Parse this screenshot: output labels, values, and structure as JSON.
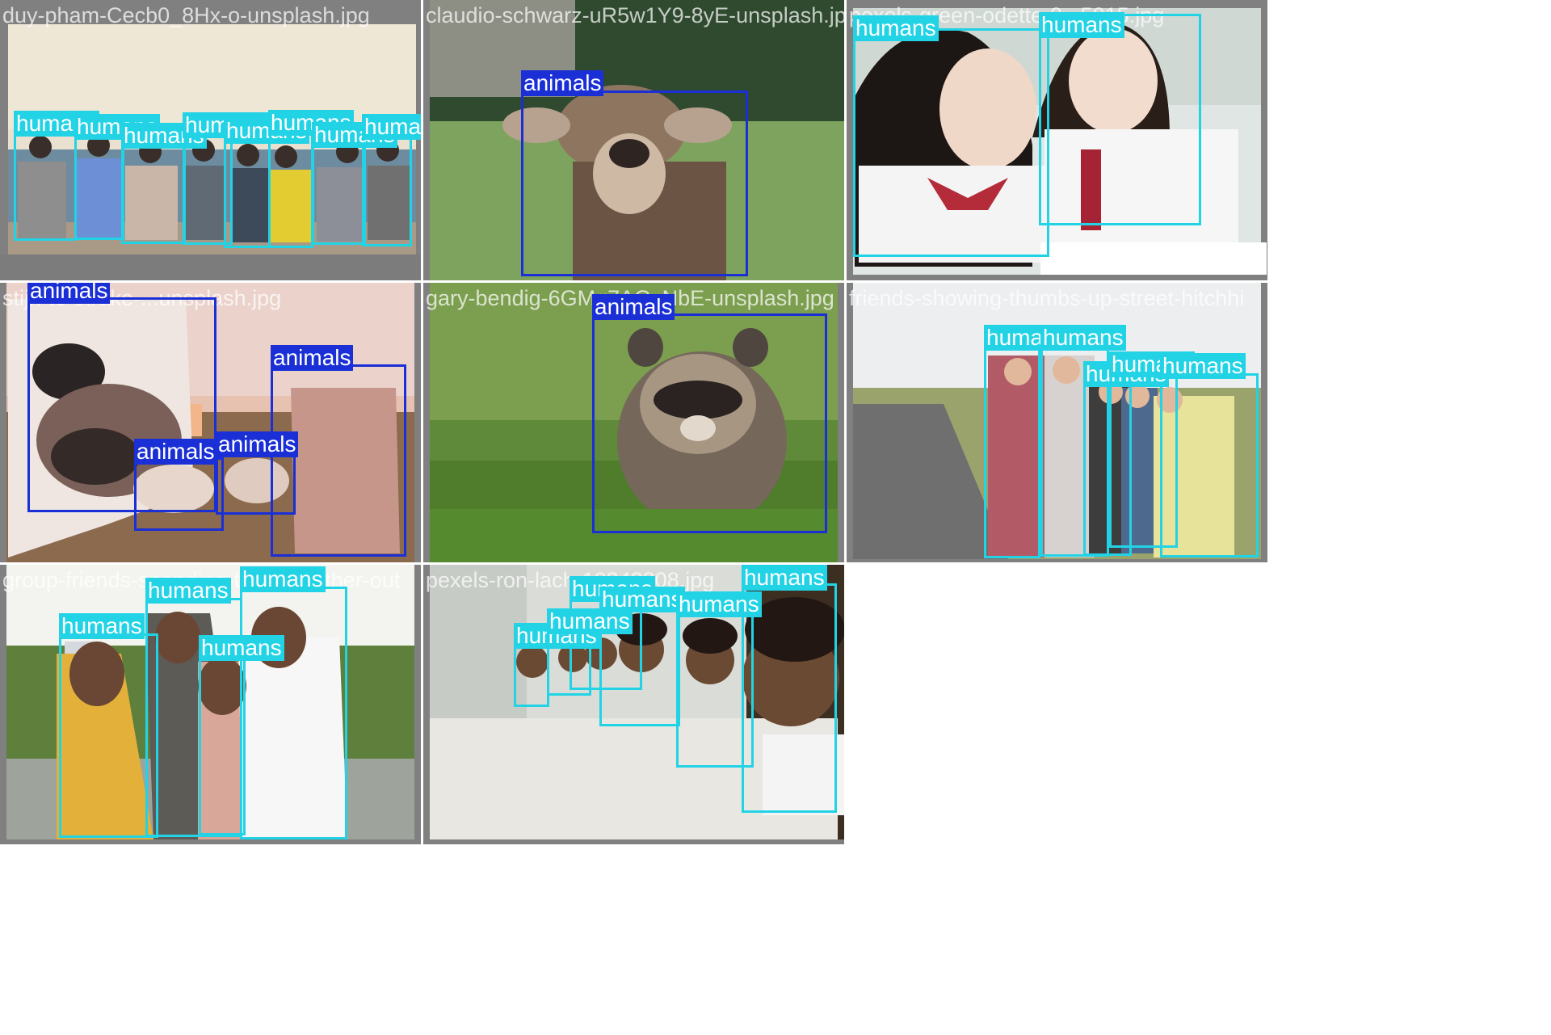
{
  "colors": {
    "humans": "#22d3e6",
    "animals": "#1a2fd6"
  },
  "class_names": {
    "humans": "humans",
    "animals": "animals"
  },
  "tiles": [
    {
      "filename": "duy-pham-Cecb0_8Hx-o-unsplash.jpg",
      "scene": "beach",
      "detections": [
        "humans",
        "humans",
        "humans",
        "humans",
        "humans",
        "humans",
        "humans",
        "humans"
      ]
    },
    {
      "filename": "claudio-schwarz-uR5w1Y9-8yE-unsplash.jpg",
      "scene": "meadow",
      "detections": [
        "animals"
      ]
    },
    {
      "filename": "pexels-green-odette-9...5015.jpg",
      "scene": "classroom",
      "detections": [
        "humans",
        "humans"
      ]
    },
    {
      "filename": "stijn-te-strake-...unsplash.jpg",
      "scene": "sunset-field",
      "detections": [
        "animals",
        "animals",
        "animals",
        "animals"
      ]
    },
    {
      "filename": "gary-bendig-6GMq7AGxNbE-unsplash.jpg",
      "scene": "grass",
      "detections": [
        "animals"
      ]
    },
    {
      "filename": "friends-showing-thumbs-up-street-hitchhi",
      "scene": "roadside",
      "detections": [
        "humans",
        "humans",
        "humans",
        "humans",
        "humans"
      ]
    },
    {
      "filename": "group-friends-spending-time-together-out",
      "scene": "terrace",
      "detections": [
        "humans",
        "humans",
        "humans",
        "humans"
      ]
    },
    {
      "filename": "pexels-ron-lach-10343808.jpg",
      "scene": "balcony",
      "detections": [
        "humans",
        "humans",
        "humans",
        "humans",
        "humans",
        "humans"
      ]
    }
  ]
}
